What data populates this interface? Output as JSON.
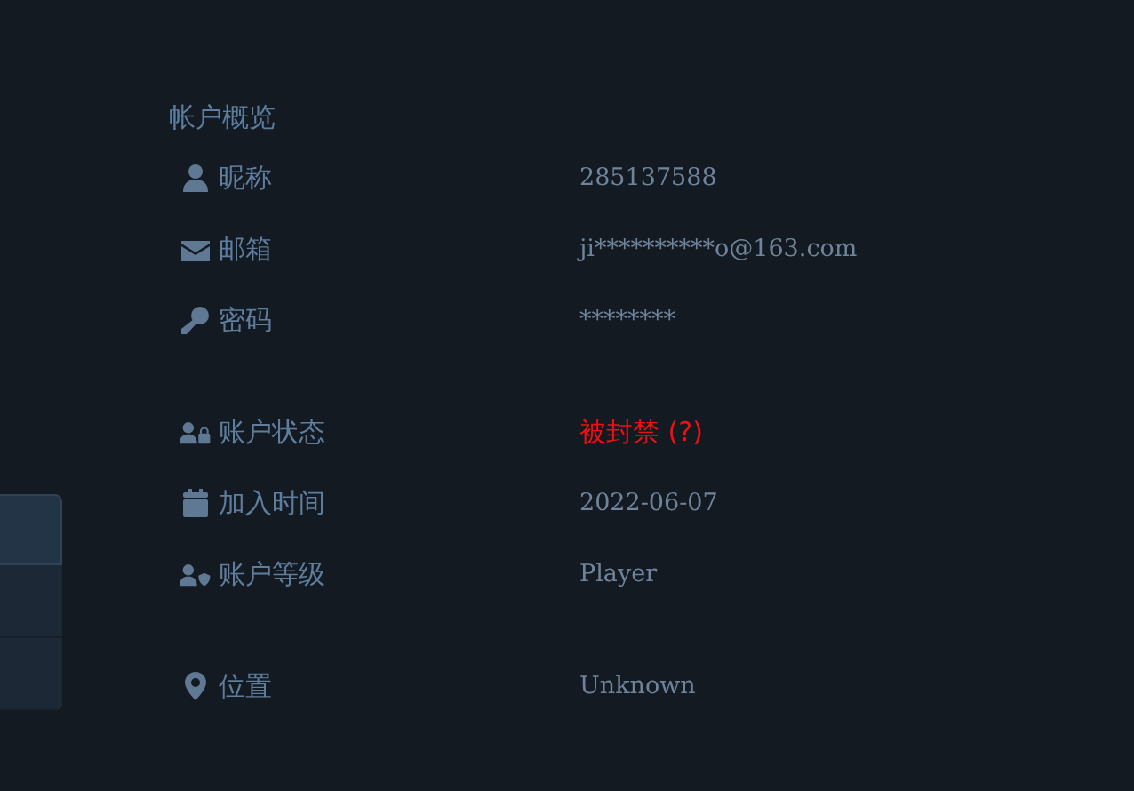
{
  "sidebar": {
    "items": [
      {
        "selected": true
      },
      {
        "selected": false
      },
      {
        "selected": false
      }
    ]
  },
  "overview": {
    "title": "帐户概览",
    "groups": [
      {
        "rows": [
          {
            "kind": "user",
            "label": "昵称",
            "value": "285137588",
            "warning": false
          },
          {
            "kind": "mail",
            "label": "邮箱",
            "value": "ji**********o@163.com",
            "warning": false
          },
          {
            "kind": "key",
            "label": "密码",
            "value": "********",
            "warning": false
          }
        ]
      },
      {
        "rows": [
          {
            "kind": "user-lock",
            "label": "账户状态",
            "value": "被封禁 (?)",
            "warning": true
          },
          {
            "kind": "calendar",
            "label": "加入时间",
            "value": "2022-06-07",
            "warning": false
          },
          {
            "kind": "user-shield",
            "label": "账户等级",
            "value": "Player",
            "warning": false
          }
        ]
      },
      {
        "rows": [
          {
            "kind": "pin",
            "label": "位置",
            "value": "Unknown",
            "warning": false
          }
        ]
      }
    ]
  }
}
